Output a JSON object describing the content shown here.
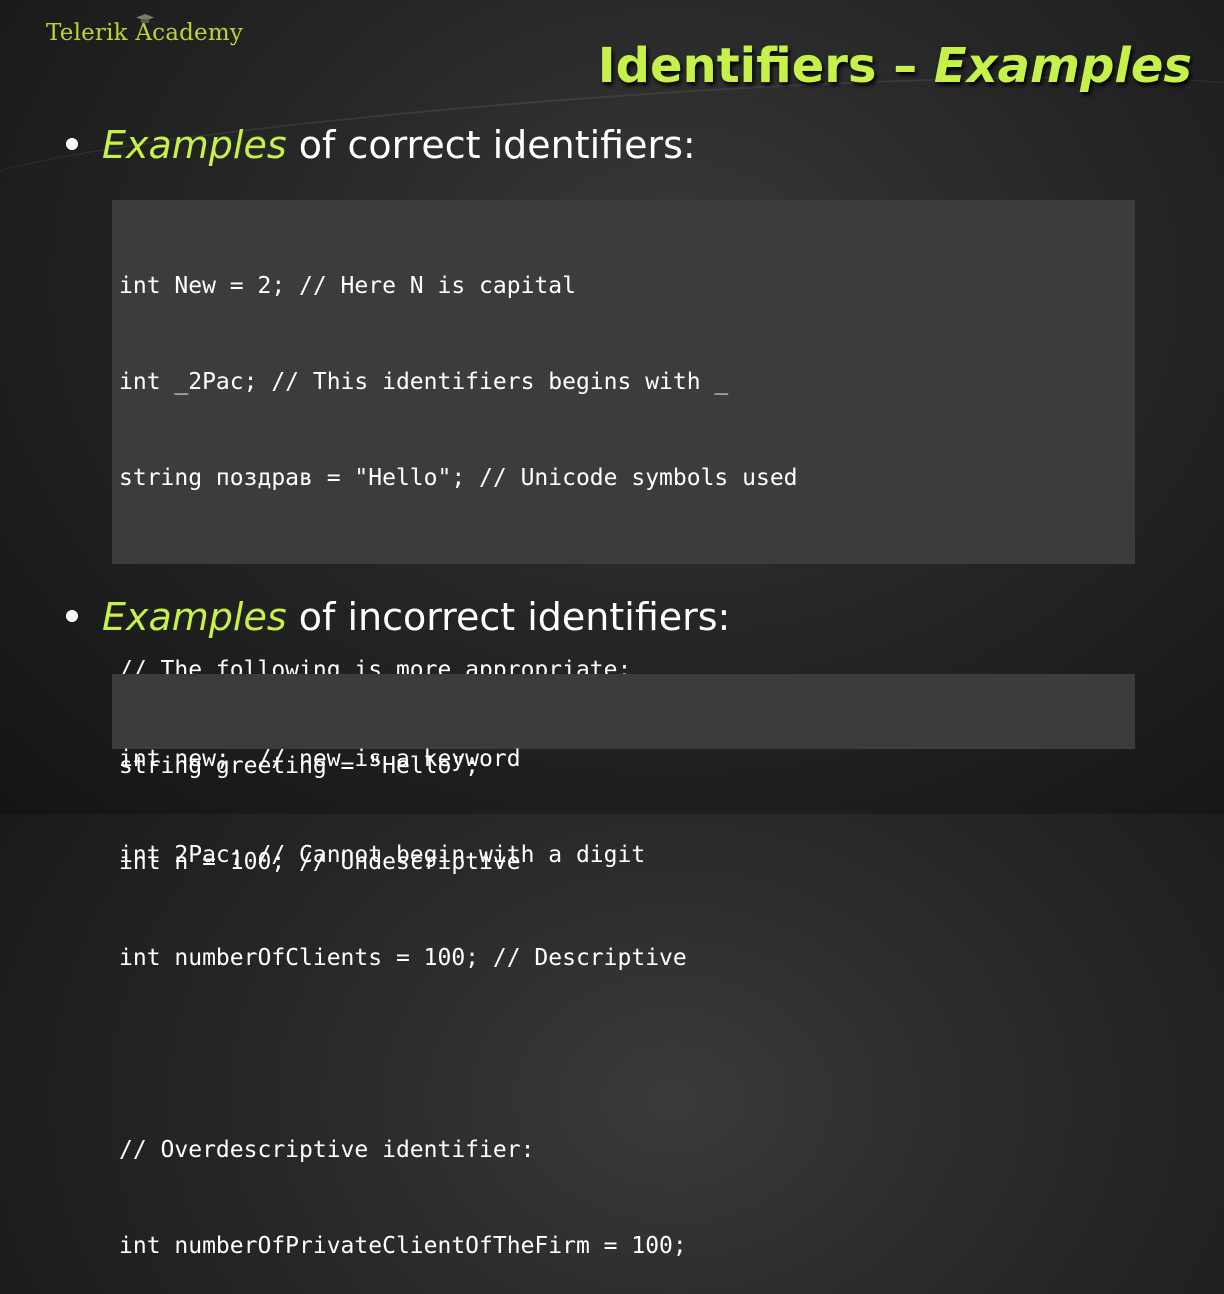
{
  "logo": {
    "text": "Telerik Academy"
  },
  "title": {
    "part1": "Identifiers – ",
    "part2": "Examples"
  },
  "bullets": [
    {
      "highlight": "Examples",
      "rest": " of correct identifiers:"
    },
    {
      "highlight": "Examples",
      "rest": " of incorrect identifiers:"
    }
  ],
  "code_correct": [
    "int New = 2; // Here N is capital",
    "int _2Pac; // This identifiers begins with _",
    "string поздрав = \"Hello\"; // Unicode symbols used",
    "",
    "// The following is more appropriate:",
    "string greeting = \"Hello\";",
    "int n = 100; // Undescriptive",
    "int numberOfClients = 100; // Descriptive",
    "",
    "// Overdescriptive identifier:",
    "int numberOfPrivateClientOfTheFirm = 100;"
  ],
  "code_incorrect": [
    "int new;  // new is a keyword",
    "int 2Pac; // Cannot begin with a digit"
  ],
  "colors": {
    "accent": "#c6f04a",
    "logo": "#b5d832",
    "code_bg": "#3c3c3c"
  }
}
